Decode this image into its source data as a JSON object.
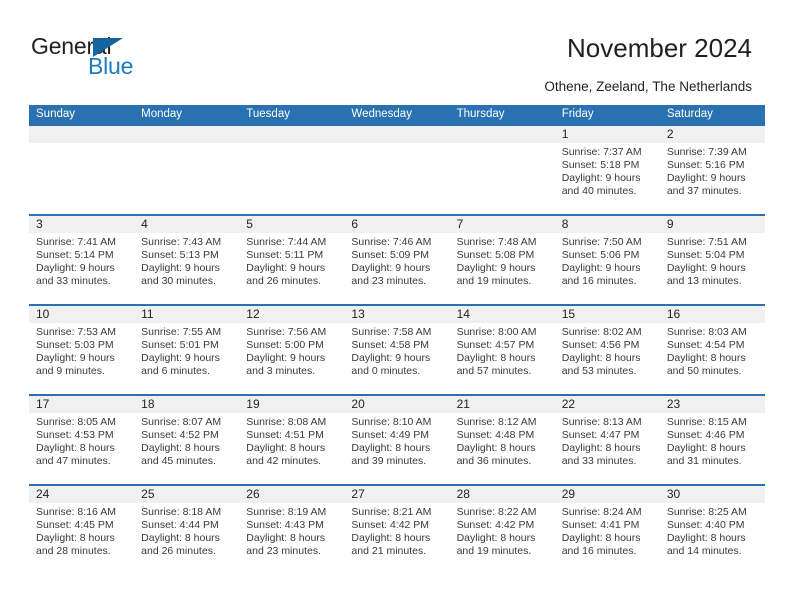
{
  "brand": {
    "name_part1": "General",
    "name_part2": "Blue",
    "logo_icon": "triangle-flag-icon",
    "accent_color": "#1c7ac0"
  },
  "header": {
    "title": "November 2024",
    "subtitle": "Othene, Zeeland, The Netherlands"
  },
  "theme": {
    "header_blue": "#2a71b1",
    "band_gray": "#f0f0f0",
    "text_dark": "#231f20"
  },
  "weekdays": [
    "Sunday",
    "Monday",
    "Tuesday",
    "Wednesday",
    "Thursday",
    "Friday",
    "Saturday"
  ],
  "weeks": [
    [
      {
        "day": "",
        "sunrise": "",
        "sunset": "",
        "daylight": ""
      },
      {
        "day": "",
        "sunrise": "",
        "sunset": "",
        "daylight": ""
      },
      {
        "day": "",
        "sunrise": "",
        "sunset": "",
        "daylight": ""
      },
      {
        "day": "",
        "sunrise": "",
        "sunset": "",
        "daylight": ""
      },
      {
        "day": "",
        "sunrise": "",
        "sunset": "",
        "daylight": ""
      },
      {
        "day": "1",
        "sunrise": "Sunrise: 7:37 AM",
        "sunset": "Sunset: 5:18 PM",
        "daylight": "Daylight: 9 hours and 40 minutes."
      },
      {
        "day": "2",
        "sunrise": "Sunrise: 7:39 AM",
        "sunset": "Sunset: 5:16 PM",
        "daylight": "Daylight: 9 hours and 37 minutes."
      }
    ],
    [
      {
        "day": "3",
        "sunrise": "Sunrise: 7:41 AM",
        "sunset": "Sunset: 5:14 PM",
        "daylight": "Daylight: 9 hours and 33 minutes."
      },
      {
        "day": "4",
        "sunrise": "Sunrise: 7:43 AM",
        "sunset": "Sunset: 5:13 PM",
        "daylight": "Daylight: 9 hours and 30 minutes."
      },
      {
        "day": "5",
        "sunrise": "Sunrise: 7:44 AM",
        "sunset": "Sunset: 5:11 PM",
        "daylight": "Daylight: 9 hours and 26 minutes."
      },
      {
        "day": "6",
        "sunrise": "Sunrise: 7:46 AM",
        "sunset": "Sunset: 5:09 PM",
        "daylight": "Daylight: 9 hours and 23 minutes."
      },
      {
        "day": "7",
        "sunrise": "Sunrise: 7:48 AM",
        "sunset": "Sunset: 5:08 PM",
        "daylight": "Daylight: 9 hours and 19 minutes."
      },
      {
        "day": "8",
        "sunrise": "Sunrise: 7:50 AM",
        "sunset": "Sunset: 5:06 PM",
        "daylight": "Daylight: 9 hours and 16 minutes."
      },
      {
        "day": "9",
        "sunrise": "Sunrise: 7:51 AM",
        "sunset": "Sunset: 5:04 PM",
        "daylight": "Daylight: 9 hours and 13 minutes."
      }
    ],
    [
      {
        "day": "10",
        "sunrise": "Sunrise: 7:53 AM",
        "sunset": "Sunset: 5:03 PM",
        "daylight": "Daylight: 9 hours and 9 minutes."
      },
      {
        "day": "11",
        "sunrise": "Sunrise: 7:55 AM",
        "sunset": "Sunset: 5:01 PM",
        "daylight": "Daylight: 9 hours and 6 minutes."
      },
      {
        "day": "12",
        "sunrise": "Sunrise: 7:56 AM",
        "sunset": "Sunset: 5:00 PM",
        "daylight": "Daylight: 9 hours and 3 minutes."
      },
      {
        "day": "13",
        "sunrise": "Sunrise: 7:58 AM",
        "sunset": "Sunset: 4:58 PM",
        "daylight": "Daylight: 9 hours and 0 minutes."
      },
      {
        "day": "14",
        "sunrise": "Sunrise: 8:00 AM",
        "sunset": "Sunset: 4:57 PM",
        "daylight": "Daylight: 8 hours and 57 minutes."
      },
      {
        "day": "15",
        "sunrise": "Sunrise: 8:02 AM",
        "sunset": "Sunset: 4:56 PM",
        "daylight": "Daylight: 8 hours and 53 minutes."
      },
      {
        "day": "16",
        "sunrise": "Sunrise: 8:03 AM",
        "sunset": "Sunset: 4:54 PM",
        "daylight": "Daylight: 8 hours and 50 minutes."
      }
    ],
    [
      {
        "day": "17",
        "sunrise": "Sunrise: 8:05 AM",
        "sunset": "Sunset: 4:53 PM",
        "daylight": "Daylight: 8 hours and 47 minutes."
      },
      {
        "day": "18",
        "sunrise": "Sunrise: 8:07 AM",
        "sunset": "Sunset: 4:52 PM",
        "daylight": "Daylight: 8 hours and 45 minutes."
      },
      {
        "day": "19",
        "sunrise": "Sunrise: 8:08 AM",
        "sunset": "Sunset: 4:51 PM",
        "daylight": "Daylight: 8 hours and 42 minutes."
      },
      {
        "day": "20",
        "sunrise": "Sunrise: 8:10 AM",
        "sunset": "Sunset: 4:49 PM",
        "daylight": "Daylight: 8 hours and 39 minutes."
      },
      {
        "day": "21",
        "sunrise": "Sunrise: 8:12 AM",
        "sunset": "Sunset: 4:48 PM",
        "daylight": "Daylight: 8 hours and 36 minutes."
      },
      {
        "day": "22",
        "sunrise": "Sunrise: 8:13 AM",
        "sunset": "Sunset: 4:47 PM",
        "daylight": "Daylight: 8 hours and 33 minutes."
      },
      {
        "day": "23",
        "sunrise": "Sunrise: 8:15 AM",
        "sunset": "Sunset: 4:46 PM",
        "daylight": "Daylight: 8 hours and 31 minutes."
      }
    ],
    [
      {
        "day": "24",
        "sunrise": "Sunrise: 8:16 AM",
        "sunset": "Sunset: 4:45 PM",
        "daylight": "Daylight: 8 hours and 28 minutes."
      },
      {
        "day": "25",
        "sunrise": "Sunrise: 8:18 AM",
        "sunset": "Sunset: 4:44 PM",
        "daylight": "Daylight: 8 hours and 26 minutes."
      },
      {
        "day": "26",
        "sunrise": "Sunrise: 8:19 AM",
        "sunset": "Sunset: 4:43 PM",
        "daylight": "Daylight: 8 hours and 23 minutes."
      },
      {
        "day": "27",
        "sunrise": "Sunrise: 8:21 AM",
        "sunset": "Sunset: 4:42 PM",
        "daylight": "Daylight: 8 hours and 21 minutes."
      },
      {
        "day": "28",
        "sunrise": "Sunrise: 8:22 AM",
        "sunset": "Sunset: 4:42 PM",
        "daylight": "Daylight: 8 hours and 19 minutes."
      },
      {
        "day": "29",
        "sunrise": "Sunrise: 8:24 AM",
        "sunset": "Sunset: 4:41 PM",
        "daylight": "Daylight: 8 hours and 16 minutes."
      },
      {
        "day": "30",
        "sunrise": "Sunrise: 8:25 AM",
        "sunset": "Sunset: 4:40 PM",
        "daylight": "Daylight: 8 hours and 14 minutes."
      }
    ]
  ]
}
